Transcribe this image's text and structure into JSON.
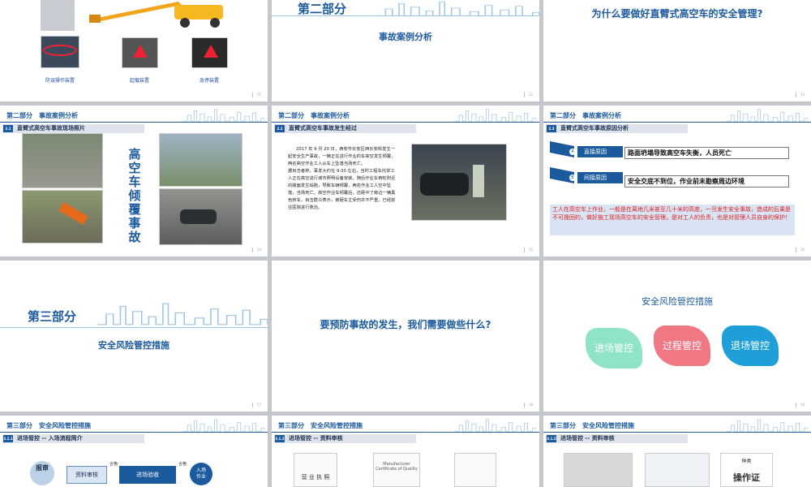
{
  "slides": {
    "s11": {
      "page": "11",
      "labels": [
        "防误操作装置",
        "起载装置",
        "急停装置"
      ]
    },
    "s12": {
      "part": "第二部分",
      "subtitle": "事故案例分析",
      "page": "12"
    },
    "s13": {
      "title": "为什么要做好直臂式高空车的安全管理?",
      "page": "13"
    },
    "s14": {
      "section": "第二部分　事故案例分析",
      "sub_num": "2.1",
      "sub": "直臂式高空车事故现场照片",
      "vertical": "高空车倾覆事故",
      "page": "14"
    },
    "s15": {
      "section": "第二部分　事故案例分析",
      "sub_num": "2.2",
      "sub": "直臂式高空车事故发生经过",
      "body": "2017 年 9 月 20 日，西安市长安区西长安街发生一起安全生产事故，一辆正在进行作业的车高空发生倾覆，两名高空作业工人从车上坠落当场死亡。\n据目击者称，事发大约在 9:30 左右，当时工程车托举工人正在高空进行城市照明设备安装，随后作业车倒轮附近的路面发生塌陷，导致车辆倾覆，两名作业工人空中坠落，当场死亡。高空作业车倾覆后，还砸中了旁边一辆黑色轿车，目击群众表示，被砸车主受伤并不严重，已经前往医院进行救治。",
      "page": "15"
    },
    "s16": {
      "section": "第二部分　事故案例分析",
      "sub_num": "2.3",
      "sub": "直臂式高空车事故原因分析",
      "a_tag": "A",
      "a_label": "直接原因",
      "a_text": "路面坍塌导致高空车失衡，人员死亡",
      "b_tag": "B",
      "b_label": "间接原因",
      "b_text": "安全交底不到位，作业前未勘察周边环境",
      "note": "工人在高空车上作业，一般是在离地几米甚至几十米的高度，一旦发生安全事故，造成的后果是不可挽回的，做好施工现场高空车的安全管理，是对工人的负责，也是对管理人员自身的保护！",
      "page": "16"
    },
    "s17": {
      "part": "第三部分",
      "subtitle": "安全风险管控措施",
      "page": "17"
    },
    "s18": {
      "title": "要预防事故的发生，我们需要做些什么?",
      "page": "18"
    },
    "s19": {
      "title": "安全风险管控措施",
      "items": [
        "进场管控",
        "过程管控",
        "退场管控"
      ],
      "page": "19"
    },
    "s20": {
      "section": "第三部分　安全风险管控措施",
      "sub_num": "3.1.1",
      "sub": "进场管控 -- 入场流程简介",
      "flow": [
        "报审",
        "资料审核",
        "合格",
        "进场验收",
        "合格",
        "入场作业"
      ]
    },
    "s21": {
      "section": "第三部分　安全风险管控措施",
      "sub_num": "3.1.2",
      "sub": "进场管控 -- 资料审核",
      "doc1": "营 业 执 照",
      "doc2": "Manufacturer Certificate of Quality"
    },
    "s22": {
      "section": "第三部分　安全风险管控措施",
      "sub_num": "3.1.2",
      "sub": "进场管控 -- 资料审核",
      "doc3": "操作证",
      "doc3_top": "种类"
    }
  },
  "colors": {
    "blue": "#1c5a9e",
    "green": "#8fe3c6",
    "red": "#f07884",
    "cyan": "#1f9fd8"
  }
}
